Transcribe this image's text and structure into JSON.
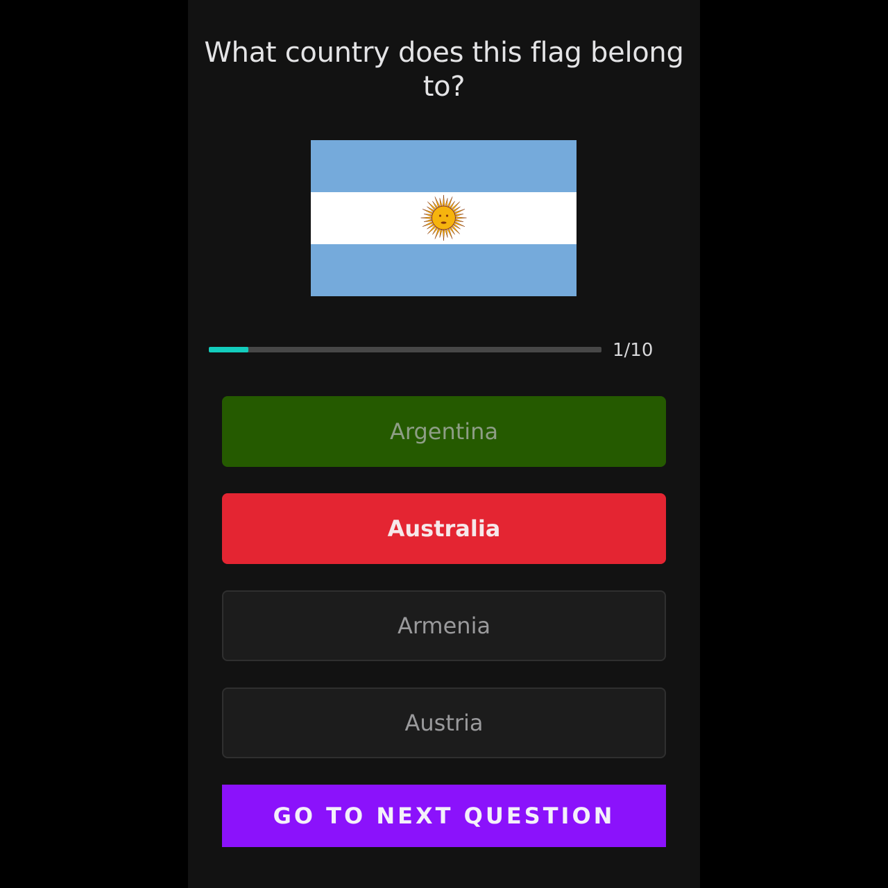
{
  "question": {
    "text": "What country does this flag belong to?"
  },
  "flag": {
    "icon": "argentina-flag-icon",
    "colors": {
      "sky_blue": "#75aadb",
      "white": "#ffffff",
      "sun": "#f6b40e",
      "sun_outline": "#85340a"
    }
  },
  "progress": {
    "current": 1,
    "total": 10,
    "fraction": 0.1,
    "text": "1/10",
    "fill_color": "#13cdbd"
  },
  "options": [
    {
      "label": "Argentina",
      "state": "correct",
      "color": "#255a00"
    },
    {
      "label": "Australia",
      "state": "selected-wrong",
      "color": "#e42532"
    },
    {
      "label": "Armenia",
      "state": "neutral",
      "color": "#1c1c1c"
    },
    {
      "label": "Austria",
      "state": "neutral",
      "color": "#1c1c1c"
    }
  ],
  "next_button": {
    "label": "GO TO NEXT QUESTION",
    "color": "#8b12fb"
  }
}
